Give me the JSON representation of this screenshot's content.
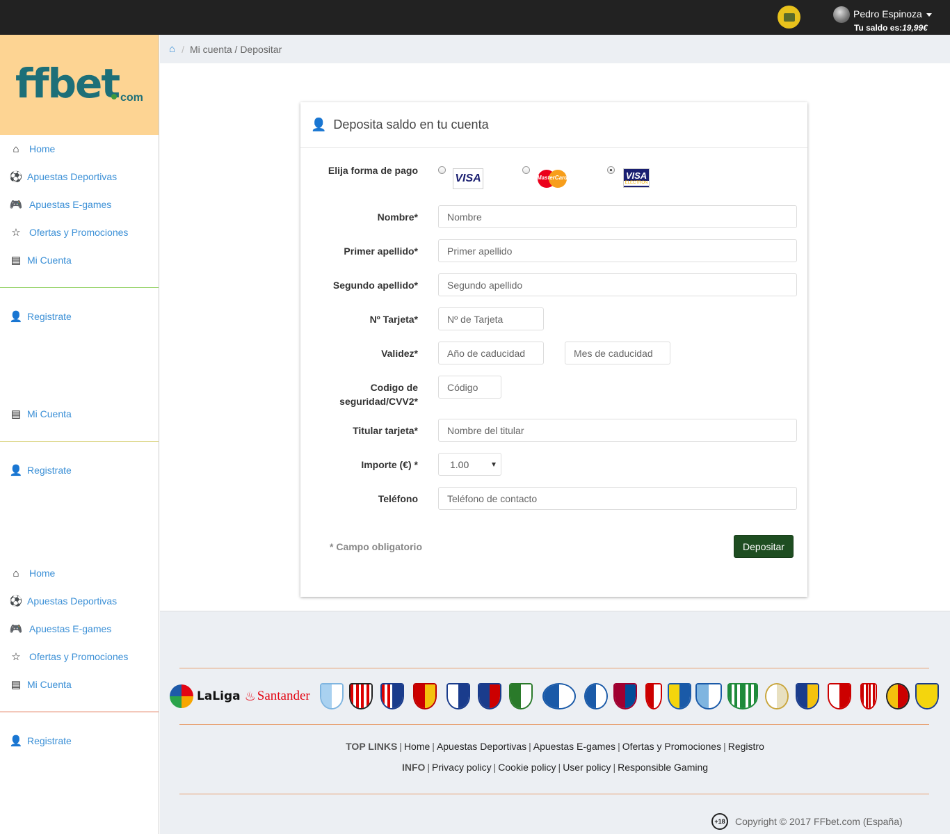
{
  "topbar": {
    "user_name": "Pedro Espinoza",
    "balance_label": "Tu saldo es:",
    "balance_amount": "19,99€"
  },
  "sidebar": {
    "logo_main": "ffbet",
    "logo_suffix": "com",
    "group1": [
      {
        "label": "Home",
        "icon": "home-icon"
      },
      {
        "label": "Apuestas Deportivas",
        "icon": "soccer-ball-icon"
      },
      {
        "label": "Apuestas E-games",
        "icon": "gamepad-icon"
      },
      {
        "label": "Ofertas y Promociones",
        "icon": "star-icon"
      },
      {
        "label": "Mi Cuenta",
        "icon": "id-card-icon"
      }
    ],
    "register_label": "Registrate",
    "account_label": "Mi Cuenta",
    "separator_colors": [
      "#8ccf5a",
      "#d9d27a",
      "#e07050"
    ]
  },
  "breadcrumb": {
    "path": "Mi cuenta / Depositar"
  },
  "form": {
    "title": "Deposita saldo en tu cuenta",
    "payment_label": "Elija forma de pago",
    "payment_options": [
      {
        "name": "VISA",
        "selected": false
      },
      {
        "name": "MasterCard",
        "selected": false
      },
      {
        "name": "VISA ELECTRON",
        "selected": true
      }
    ],
    "fields": {
      "nombre": {
        "label": "Nombre*",
        "placeholder": "Nombre"
      },
      "apellido1": {
        "label": "Primer apellido*",
        "placeholder": "Primer apellido"
      },
      "apellido2": {
        "label": "Segundo apellido*",
        "placeholder": "Segundo apellido"
      },
      "tarjeta": {
        "label": "Nº Tarjeta*",
        "placeholder": "Nº de Tarjeta"
      },
      "validez": {
        "label": "Validez*",
        "placeholder_year": "Año de caducidad",
        "placeholder_month": "Mes de caducidad"
      },
      "cvv_line1": "Codigo de",
      "cvv_line2": "seguridad/CVV2*",
      "cvv_placeholder": "Código",
      "titular": {
        "label": "Titular tarjeta*",
        "placeholder": "Nombre del titular"
      },
      "importe": {
        "label": "Importe (€) *",
        "value": "1.00"
      },
      "telefono": {
        "label": "Teléfono",
        "placeholder": "Teléfono de contacto"
      }
    },
    "required_note": "* Campo obligatorio",
    "submit_label": "Depositar",
    "submit_color": "#1e4d21"
  },
  "footer": {
    "laliga_text": "LaLiga",
    "sponsor_text": "Santander",
    "top_links_heading": "TOP LINKS",
    "top_links": [
      "Home",
      "Apuestas Deportivas",
      "Apuestas E-games",
      "Ofertas y Promociones",
      "Registro"
    ],
    "info_heading": "INFO",
    "info_links": [
      "Privacy policy",
      "Cookie policy",
      "User policy",
      "Responsible Gaming"
    ],
    "age_badge": "+18",
    "copyright": "Copyright © 2017 FFbet.com (España)"
  }
}
